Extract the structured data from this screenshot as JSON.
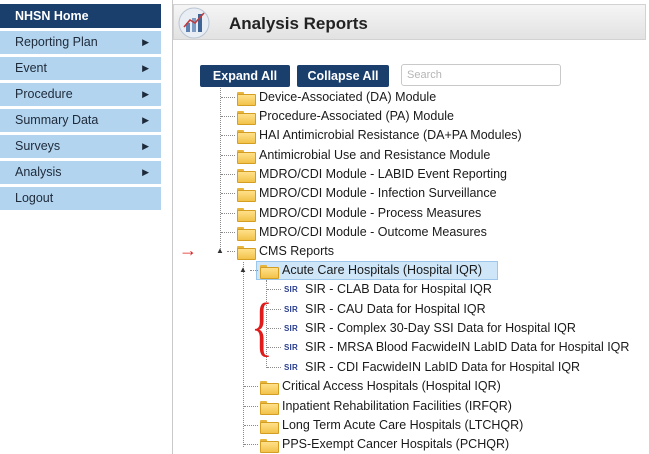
{
  "sidebar": {
    "home_label": "NHSN Home",
    "items": [
      {
        "label": "Reporting Plan",
        "has_submenu": true
      },
      {
        "label": "Event",
        "has_submenu": true
      },
      {
        "label": "Procedure",
        "has_submenu": true
      },
      {
        "label": "Summary Data",
        "has_submenu": true
      },
      {
        "label": "Surveys",
        "has_submenu": true
      },
      {
        "label": "Analysis",
        "has_submenu": true
      },
      {
        "label": "Logout",
        "has_submenu": false
      }
    ],
    "arrow_glyph": "▶"
  },
  "header": {
    "title": "Analysis Reports",
    "icon": "analysis-chart-icon"
  },
  "toolbar": {
    "expand_all_label": "Expand All",
    "collapse_all_label": "Collapse All",
    "search_placeholder": "Search"
  },
  "tree": {
    "modules": [
      "Device-Associated (DA) Module",
      "Procedure-Associated (PA) Module",
      "HAI Antimicrobial Resistance (DA+PA Modules)",
      "Antimicrobial Use and Resistance Module",
      "MDRO/CDI Module - LABID Event Reporting",
      "MDRO/CDI Module - Infection Surveillance",
      "MDRO/CDI Module - Process Measures",
      "MDRO/CDI Module - Outcome Measures"
    ],
    "cms_reports_label": "CMS Reports",
    "selected_folder_label": "Acute Care Hospitals (Hospital IQR)",
    "sir_badge": "SIR",
    "sir_reports": [
      "SIR - CLAB Data for Hospital IQR",
      "SIR - CAU Data for Hospital IQR",
      "SIR - Complex 30-Day SSI Data for Hospital IQR",
      "SIR - MRSA Blood FacwideIN LabID Data for Hospital IQR",
      "SIR - CDI FacwideIN LabID Data for Hospital IQR"
    ],
    "other_cms_folders": [
      "Critical Access Hospitals (Hospital IQR)",
      "Inpatient Rehabilitation Facilities (IRFQR)",
      "Long Term Acute Care Hospitals (LTCHQR)",
      "PPS-Exempt Cancer Hospitals (PCHQR)"
    ]
  },
  "colors": {
    "nav_home_bg": "#1a3f6c",
    "nav_item_bg": "#b3d4ee",
    "button_bg": "#1a3f6c",
    "selected_bg": "#cfe6f8",
    "annotation_red": "#e01b1b"
  }
}
